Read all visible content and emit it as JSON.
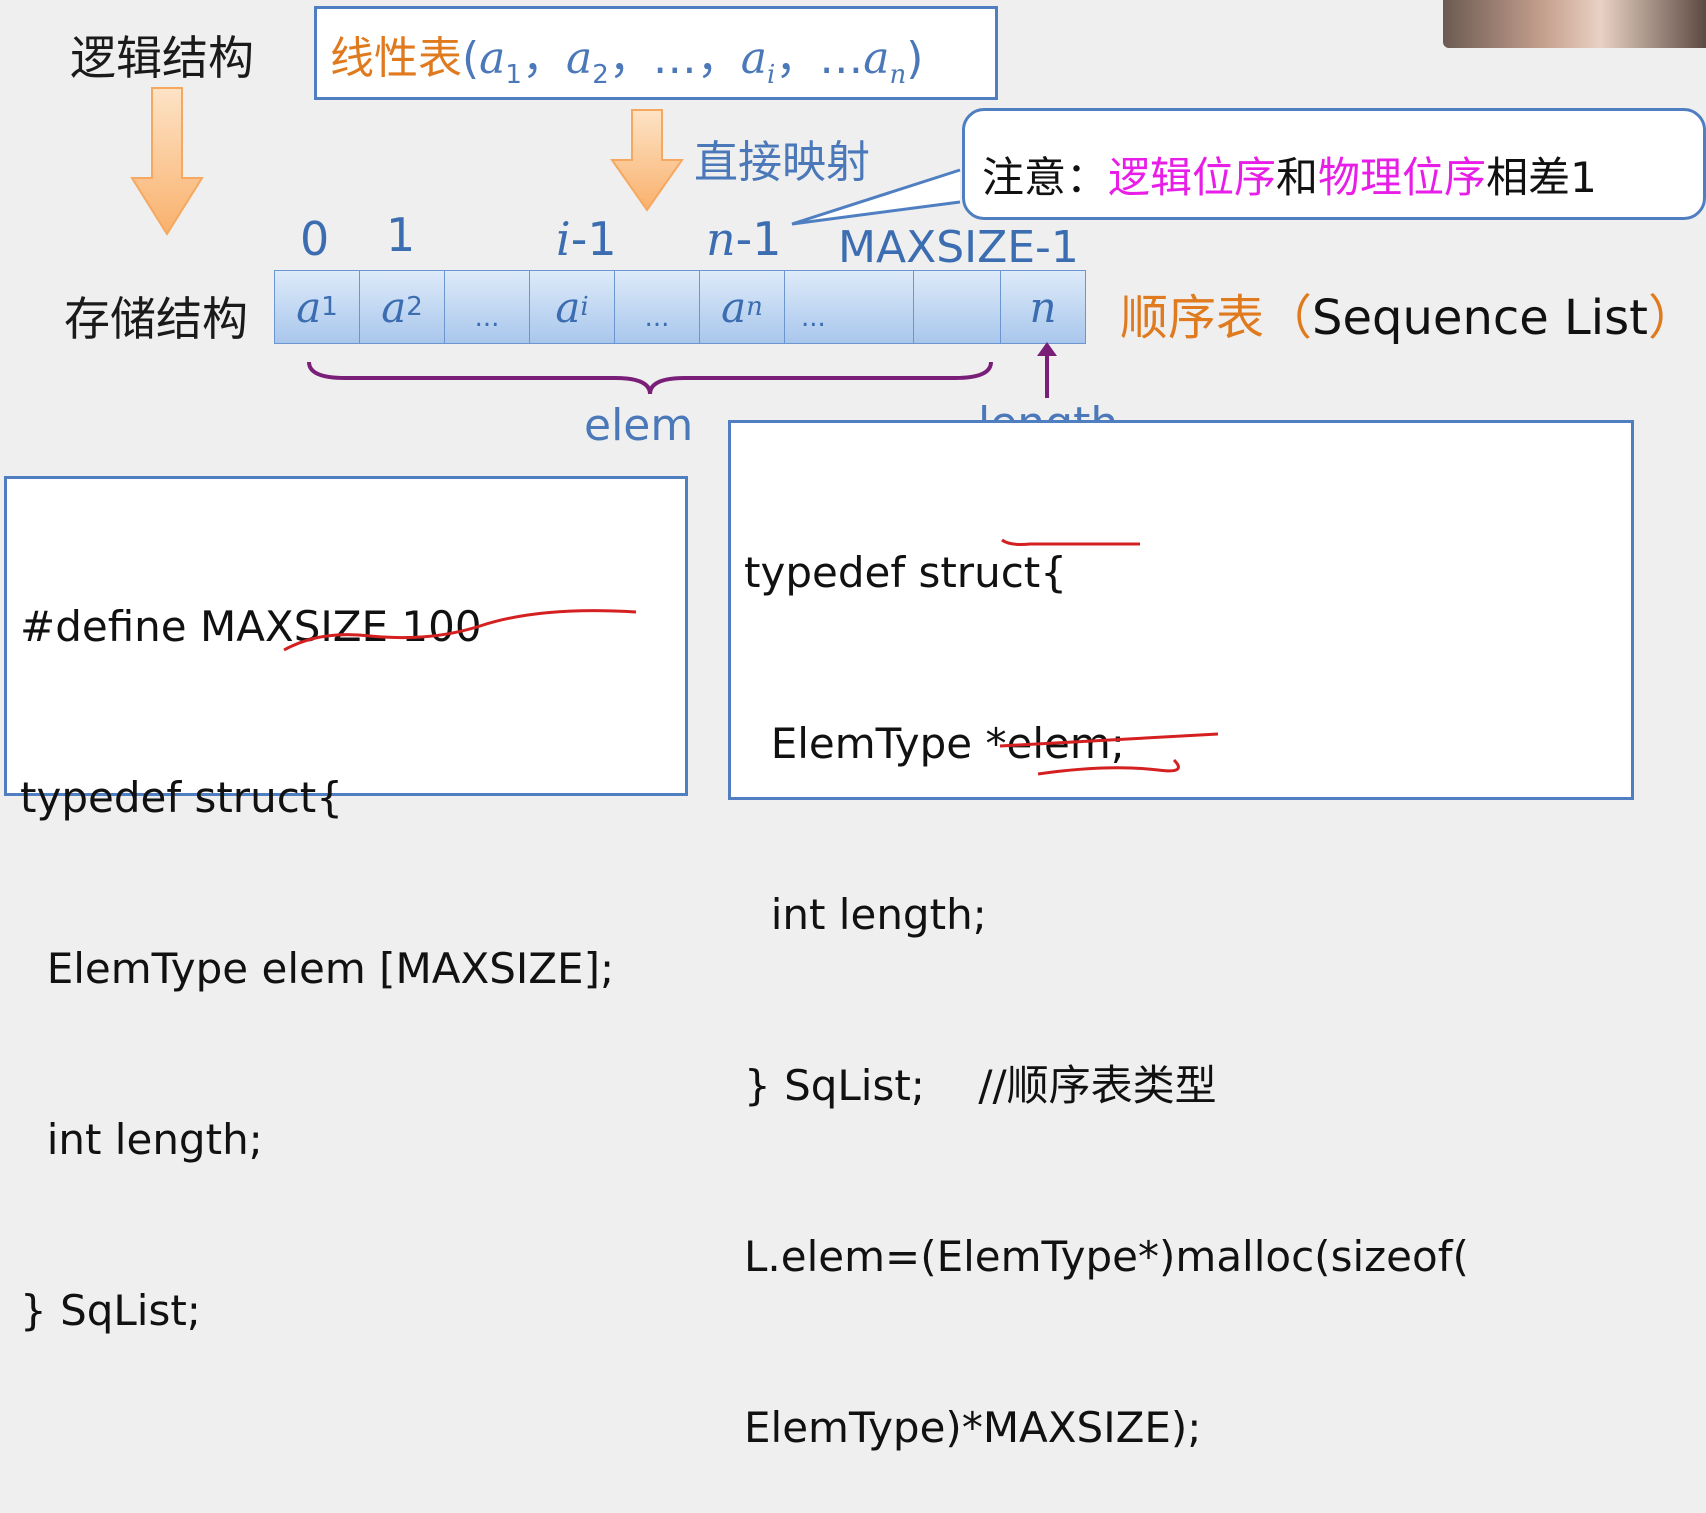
{
  "labels": {
    "logic": "逻辑结构",
    "storage": "存储结构",
    "mapping": "直接映射",
    "elem": "elem",
    "length": "length"
  },
  "linear_table": {
    "prefix": "线性表",
    "open": "(",
    "a": "a",
    "s1": "1",
    "s2": "2",
    "si": "i",
    "sn": "n",
    "comma": "，",
    "ellipsis": "…",
    "close": ")"
  },
  "note": {
    "prefix": "注意：",
    "logic_order": "逻辑位序",
    "and": "和",
    "physical_order": "物理位序",
    "suffix": "相差1"
  },
  "indices": [
    "0",
    "1",
    "i",
    "-1",
    "n",
    "-1",
    "MAXSIZE-1"
  ],
  "cells": [
    {
      "var": "a",
      "sub": "1"
    },
    {
      "var": "a",
      "sub": "2"
    },
    {
      "text": "..."
    },
    {
      "var": "a",
      "sub": "i"
    },
    {
      "text": "..."
    },
    {
      "var": "a",
      "sub": "n"
    },
    {
      "text": "..."
    },
    {
      "text": ""
    },
    {
      "var": "n",
      "sub": ""
    }
  ],
  "seq_list": {
    "name": "顺序表",
    "open": "（",
    "english": "Sequence List",
    "close": "）"
  },
  "code_left": [
    "#define MAXSIZE 100",
    "typedef struct{",
    "  ElemType elem [MAXSIZE];",
    "  int length;",
    "} SqList;"
  ],
  "code_right": [
    "typedef struct{",
    "  ElemType *elem;",
    "  int length;",
    "} SqList;    //顺序表类型",
    "L.elem=(ElemType*)malloc(sizeof(",
    "ElemType)*MAXSIZE);"
  ],
  "colors": {
    "accent_blue": "#4a78b8",
    "orange": "#e07a1f",
    "magenta": "#e81ee8",
    "brace_purple": "#7a1f78",
    "red_mark": "#d42020"
  }
}
